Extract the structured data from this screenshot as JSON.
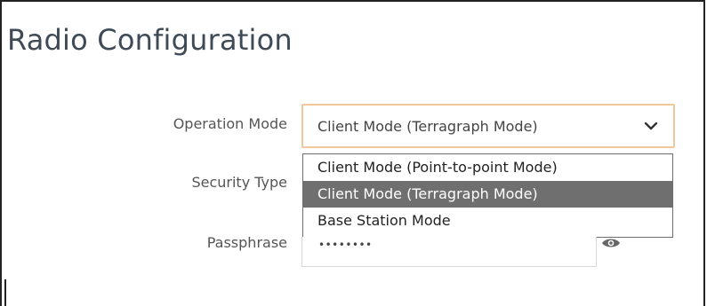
{
  "page": {
    "title": "Radio Configuration"
  },
  "form": {
    "operation_mode": {
      "label": "Operation Mode",
      "selected": "Client Mode (Terragraph Mode)",
      "options": [
        {
          "label": "Client Mode (Point-to-point Mode)",
          "selected": false
        },
        {
          "label": "Client Mode (Terragraph Mode)",
          "selected": true
        },
        {
          "label": "Base Station Mode",
          "selected": false
        }
      ]
    },
    "security_type": {
      "label": "Security Type"
    },
    "passphrase": {
      "label": "Passphrase",
      "masked_value": "••••••••"
    }
  },
  "icons": {
    "select_arrow": "chevron-down-icon",
    "reveal_password": "eye-icon"
  },
  "colors": {
    "title": "#3f4a57",
    "select_focus_border": "#f1c89a",
    "option_highlight": "#6f6f6f",
    "label": "#555555"
  }
}
